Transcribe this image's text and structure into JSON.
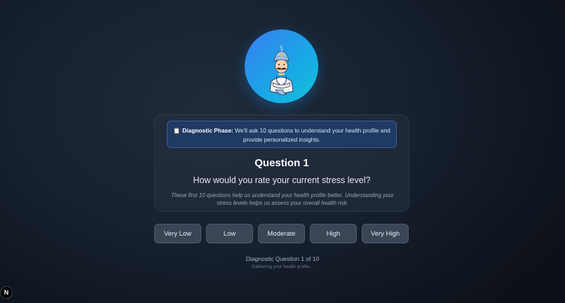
{
  "avatar": {
    "icon": "doctor-genie-icon"
  },
  "notice": {
    "emoji": "📋",
    "label": "Diagnostic Phase:",
    "text": " We'll ask 10 questions to understand your health profile and provide personalized insights."
  },
  "question": {
    "title": "Question 1",
    "text": "How would you rate your current stress level?",
    "help": "These first 10 questions help us understand your health profile better. Understanding your stress levels helps us assess your overall health risk."
  },
  "answers": [
    "Very Low",
    "Low",
    "Moderate",
    "High",
    "Very High"
  ],
  "progress": {
    "text": "Diagnostic Question 1 of 10",
    "sub": "Gathering your health profile..."
  },
  "nextjs_badge": "N",
  "colors": {
    "accent_gradient_start": "#3a7df0",
    "accent_gradient_end": "#12c2dc",
    "notice_bg": "#1f3a63",
    "button_bg": "#3a4556"
  }
}
